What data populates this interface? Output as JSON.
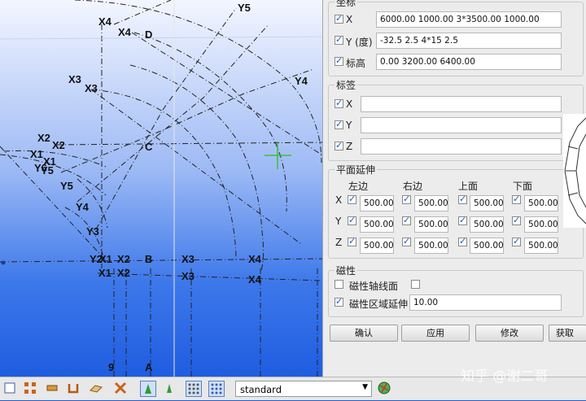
{
  "canvas": {
    "axis_labels": [
      "X4",
      "X4",
      "D",
      "Y5",
      "X3",
      "X3",
      "Y4",
      "X2",
      "X2",
      "X1",
      "X1",
      "Y6",
      "Y5",
      "C",
      "Y5",
      "Y4",
      "Y3",
      "Y2",
      "X1",
      "X2",
      "B",
      "X3",
      "X4",
      "X4",
      "X1",
      "X2",
      "X3",
      "9",
      "A"
    ],
    "colors": {
      "background_top": "#f4f6ff",
      "background_bottom": "#1f5de0",
      "grid_line": "#222222",
      "cursor": "#3bbf3b"
    }
  },
  "dialog": {
    "coord_group": {
      "title": "坐标",
      "rows": [
        {
          "label": "X",
          "checked": true,
          "value": "6000.00 1000.00 3*3500.00 1000.00"
        },
        {
          "label": "Y (度)",
          "checked": true,
          "value": "-32.5 2.5 4*15 2.5"
        },
        {
          "label": "标高",
          "checked": true,
          "value": "0.00 3200.00 6400.00"
        }
      ]
    },
    "tag_group": {
      "title": "标签",
      "rows": [
        {
          "label": "X",
          "checked": true,
          "value": ""
        },
        {
          "label": "Y",
          "checked": true,
          "value": ""
        },
        {
          "label": "Z",
          "checked": true,
          "value": ""
        }
      ]
    },
    "extend_group": {
      "title": "平面延伸",
      "headers": [
        "左边",
        "右边",
        "上面",
        "下面"
      ],
      "rows": [
        {
          "label": "X",
          "values": [
            "500.00",
            "500.00",
            "500.00",
            "500.00"
          ]
        },
        {
          "label": "Y",
          "values": [
            "500.00",
            "500.00",
            "500.00",
            "500.00"
          ]
        },
        {
          "label": "Z",
          "values": [
            "500.00",
            "500.00",
            "500.00",
            "500.00"
          ]
        }
      ]
    },
    "magnet_group": {
      "title": "磁性",
      "axis_label": "磁性轴线面",
      "axis_checked": false,
      "zone_label": "磁性区域延伸",
      "zone_checked": true,
      "zone_value": "10.00"
    },
    "buttons": {
      "ok": "确认",
      "apply": "应用",
      "modify": "修改",
      "get": "获取"
    }
  },
  "toolbar": {
    "combo_value": "standard",
    "icons": [
      "select-icon",
      "grid-icon",
      "beam-icon",
      "channel-icon",
      "plate-icon",
      "tools-icon",
      "point-icon",
      "point2-icon",
      "grid-dots-icon",
      "grid-dots2-icon",
      "globe-icon"
    ]
  },
  "watermark": "知乎 @谢二哥"
}
